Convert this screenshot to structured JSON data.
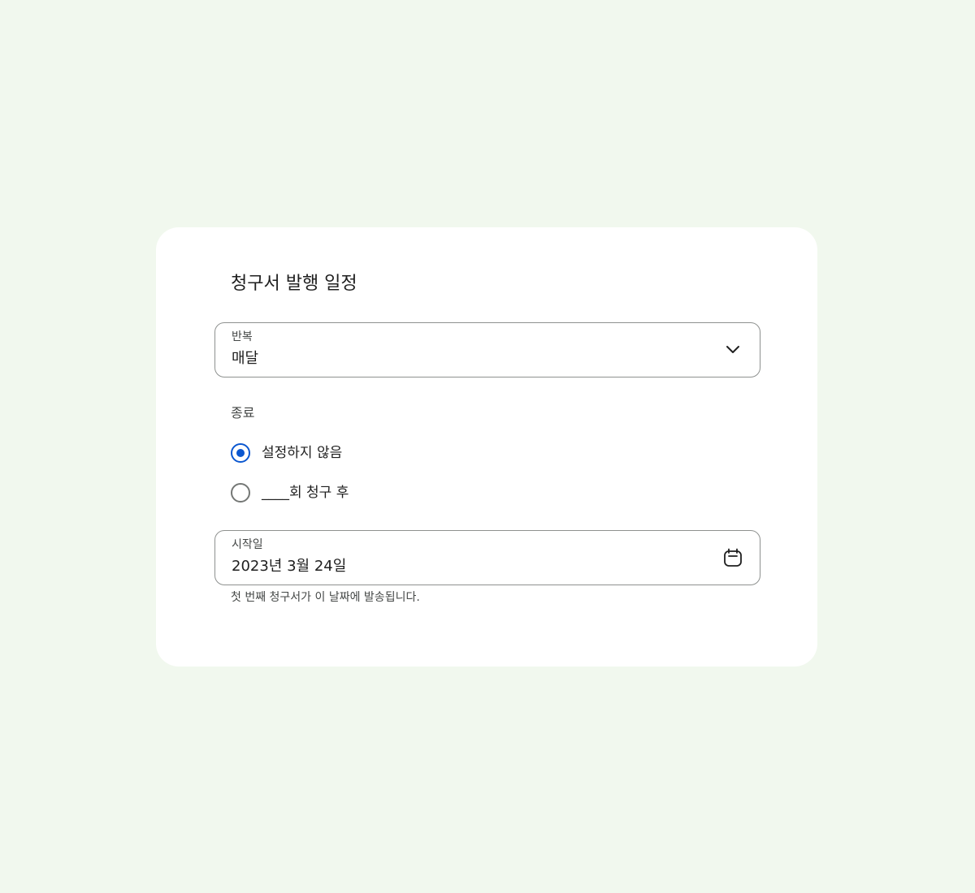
{
  "dialog": {
    "title": "청구서 발행 일정"
  },
  "repeat": {
    "label": "반복",
    "value": "매달",
    "icon": "chevron-down-icon"
  },
  "end": {
    "label": "종료",
    "options": [
      {
        "label": "설정하지 않음",
        "selected": true
      },
      {
        "label": "____회 청구 후",
        "selected": false
      }
    ]
  },
  "start_date": {
    "label": "시작일",
    "value": "2023년 3월 24일",
    "icon": "calendar-icon",
    "helper": "첫 번째 청구서가 이 날짜에 발송됩니다."
  },
  "colors": {
    "background": "#f1f8ee",
    "card": "#ffffff",
    "accent": "#0b57d0",
    "outline": "#8e918f"
  }
}
